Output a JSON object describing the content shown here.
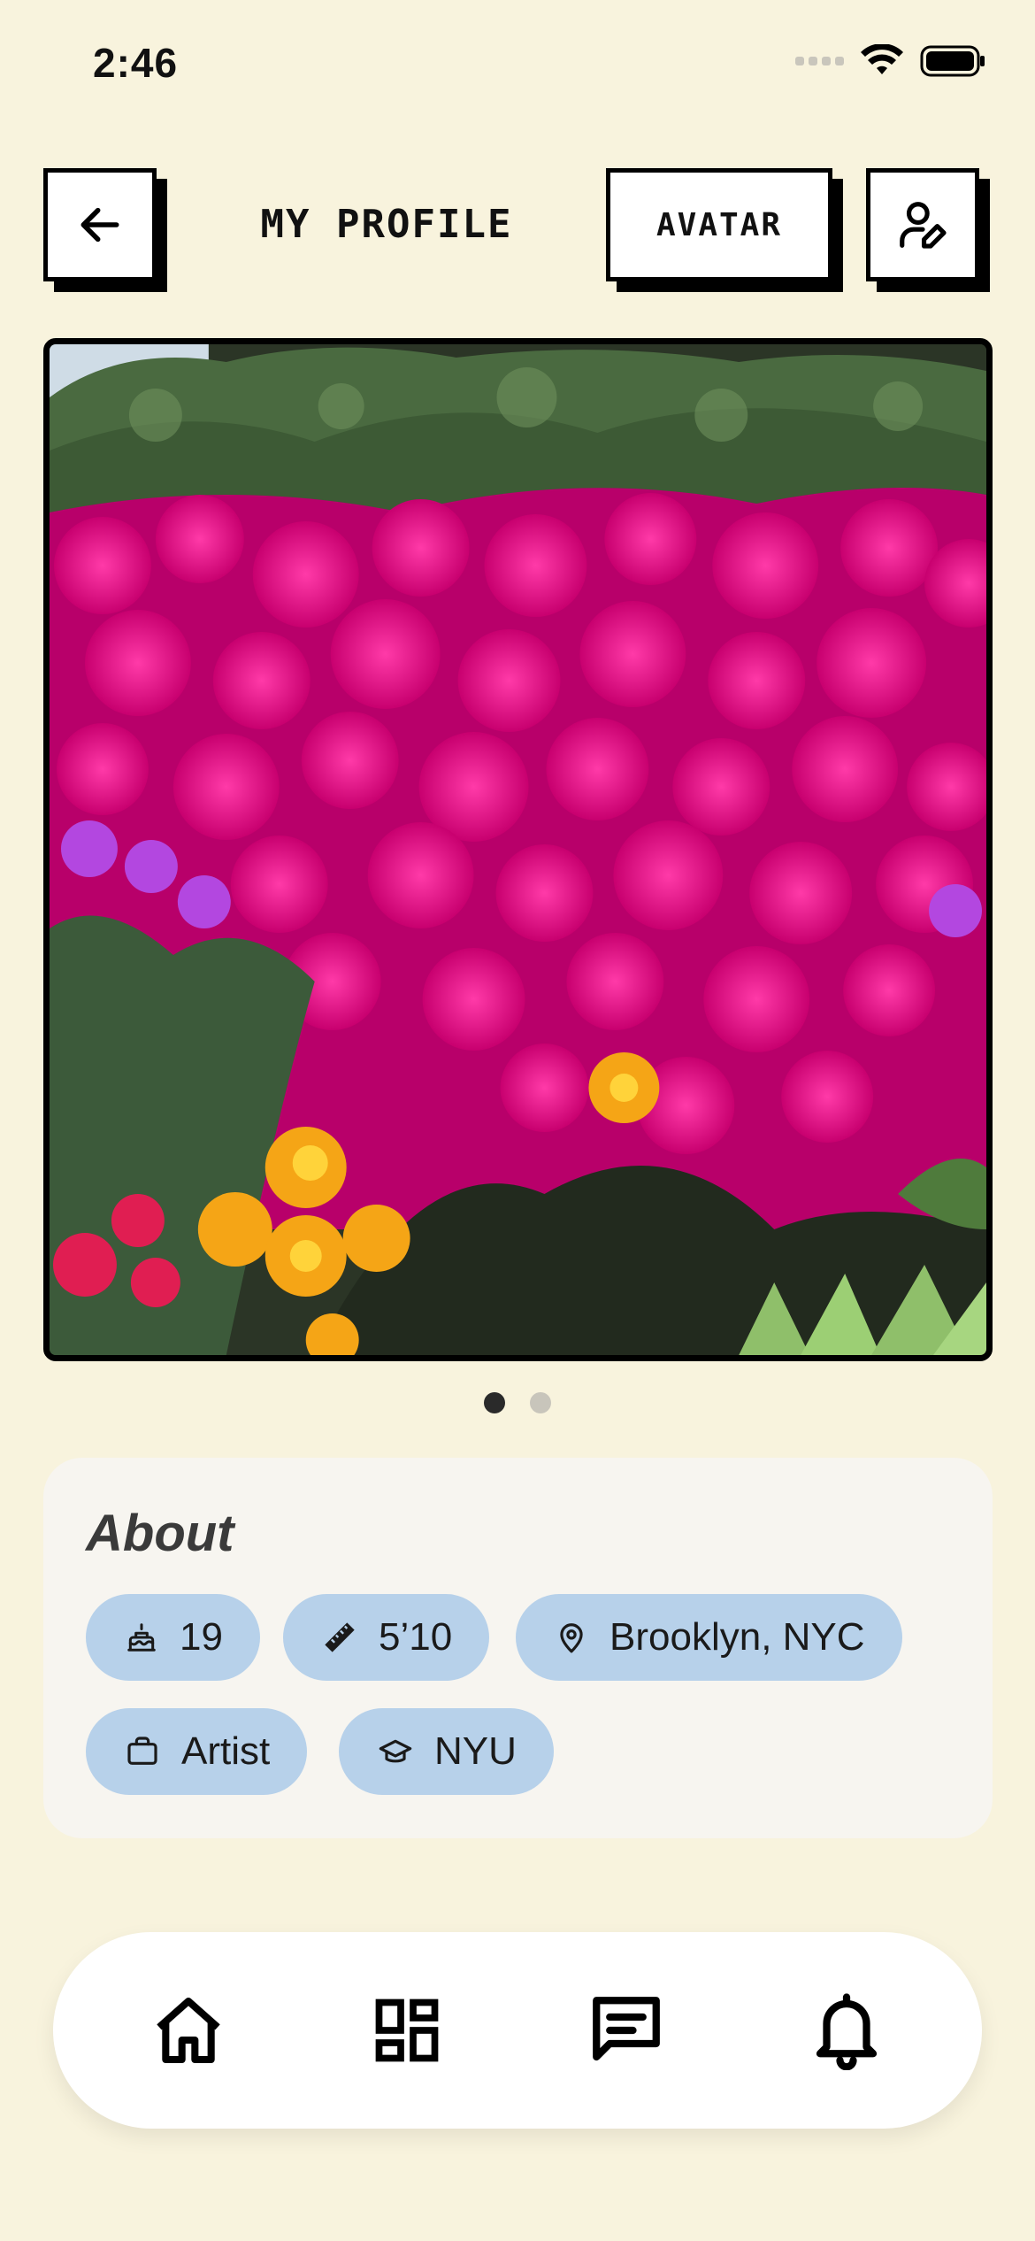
{
  "status_bar": {
    "time": "2:46"
  },
  "header": {
    "title": "MY PROFILE",
    "avatar_label": "AVATAR",
    "back_icon": "arrow-left-icon",
    "edit_icon": "user-edit-icon"
  },
  "photo": {
    "description_icon": "profile-photo",
    "page_count": 2,
    "active_page": 1
  },
  "about": {
    "title": "About",
    "chips": [
      {
        "icon": "cake-icon",
        "label": "19"
      },
      {
        "icon": "ruler-icon",
        "label": "5’10"
      },
      {
        "icon": "location-pin-icon",
        "label": "Brooklyn, NYC"
      },
      {
        "icon": "briefcase-icon",
        "label": "Artist"
      },
      {
        "icon": "graduation-cap-icon",
        "label": "NYU"
      }
    ]
  },
  "nav": {
    "items": [
      {
        "icon": "home-icon"
      },
      {
        "icon": "dashboard-icon"
      },
      {
        "icon": "chat-icon"
      },
      {
        "icon": "bell-icon"
      }
    ]
  },
  "colors": {
    "background": "#f8f3dd",
    "chip": "#b7d1ea",
    "card": "#f7f5f0"
  }
}
